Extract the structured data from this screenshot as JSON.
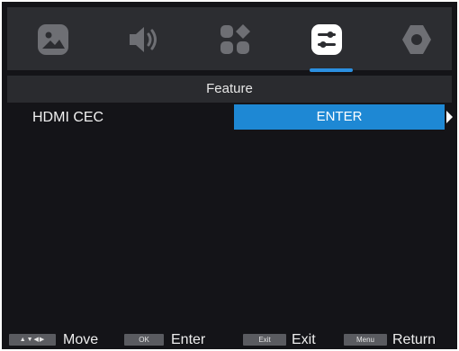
{
  "tabs": [
    {
      "icon": "picture-icon"
    },
    {
      "icon": "speaker-icon"
    },
    {
      "icon": "apps-icon"
    },
    {
      "icon": "sliders-icon",
      "active": true
    },
    {
      "icon": "settings-icon"
    }
  ],
  "section_title": "Feature",
  "menu_items": [
    {
      "label": "HDMI CEC",
      "value": "ENTER"
    }
  ],
  "footer": {
    "keys": [
      {
        "key": "▲▼◀▶",
        "label": "Move"
      },
      {
        "key": "OK",
        "label": "Enter"
      },
      {
        "key": "Exit",
        "label": "Exit"
      },
      {
        "key": "Menu",
        "label": "Return"
      }
    ]
  },
  "colors": {
    "accent": "#1e88d4",
    "background": "#141418",
    "panel": "#2c2d31",
    "icon_gray": "#6e6f74",
    "active_icon": "#ffffff"
  }
}
